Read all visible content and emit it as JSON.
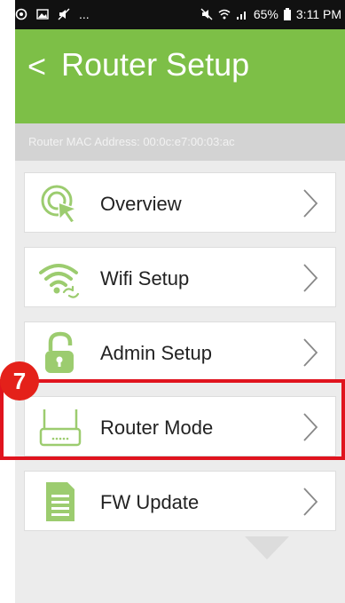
{
  "status_bar": {
    "left_text": "...",
    "battery": "65%",
    "time": "3:11 PM"
  },
  "header": {
    "back_icon": "<",
    "title": "Router Setup",
    "color": "#7dbf47"
  },
  "mac_address_label": "Router MAC Address: 00:0c:e7:00:03:ac",
  "menu": [
    {
      "label": "Overview",
      "icon": "overview-icon"
    },
    {
      "label": "Wifi Setup",
      "icon": "wifi-icon"
    },
    {
      "label": "Admin Setup",
      "icon": "lock-icon"
    },
    {
      "label": "Router Mode",
      "icon": "router-icon"
    },
    {
      "label": "FW Update",
      "icon": "document-icon"
    }
  ],
  "annotation": {
    "step_number": "7",
    "color": "#e0141e"
  }
}
